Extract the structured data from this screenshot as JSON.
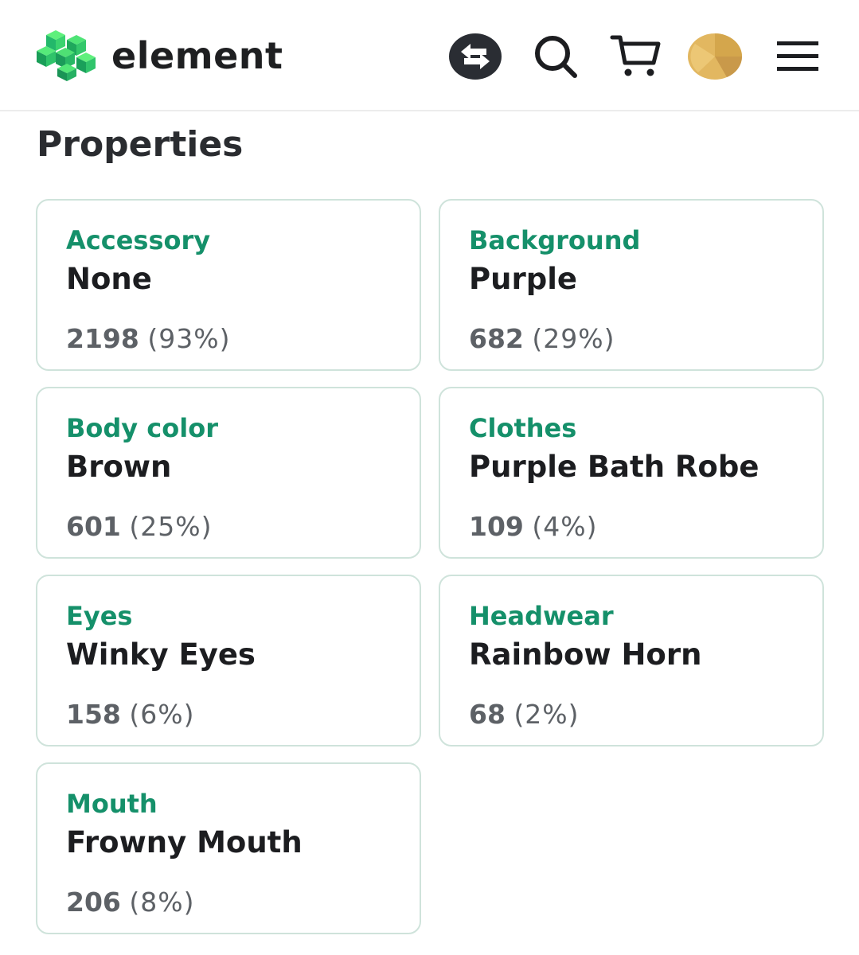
{
  "header": {
    "brand": "element",
    "icons": {
      "swap": "swap-arrows-icon",
      "search": "search-icon",
      "cart": "cart-icon",
      "avatar": "avatar",
      "menu": "menu-icon"
    },
    "colors": {
      "logo_green": "#2ecc71",
      "avatar_gold": "#e2b760"
    }
  },
  "section": {
    "title": "Properties"
  },
  "properties": [
    {
      "type": "Accessory",
      "value": "None",
      "count": "2198",
      "percent": "(93%)"
    },
    {
      "type": "Background",
      "value": "Purple",
      "count": "682",
      "percent": "(29%)"
    },
    {
      "type": "Body color",
      "value": "Brown",
      "count": "601",
      "percent": "(25%)"
    },
    {
      "type": "Clothes",
      "value": "Purple Bath Robe",
      "count": "109",
      "percent": "(4%)"
    },
    {
      "type": "Eyes",
      "value": "Winky Eyes",
      "count": "158",
      "percent": "(6%)"
    },
    {
      "type": "Headwear",
      "value": "Rainbow Horn",
      "count": "68",
      "percent": "(2%)"
    },
    {
      "type": "Mouth",
      "value": "Frowny Mouth",
      "count": "206",
      "percent": "(8%)"
    }
  ],
  "theme": {
    "accent": "#15906a",
    "card_border": "#cfe3db",
    "text_dark": "#1c1d20",
    "text_muted": "#5d6166"
  }
}
